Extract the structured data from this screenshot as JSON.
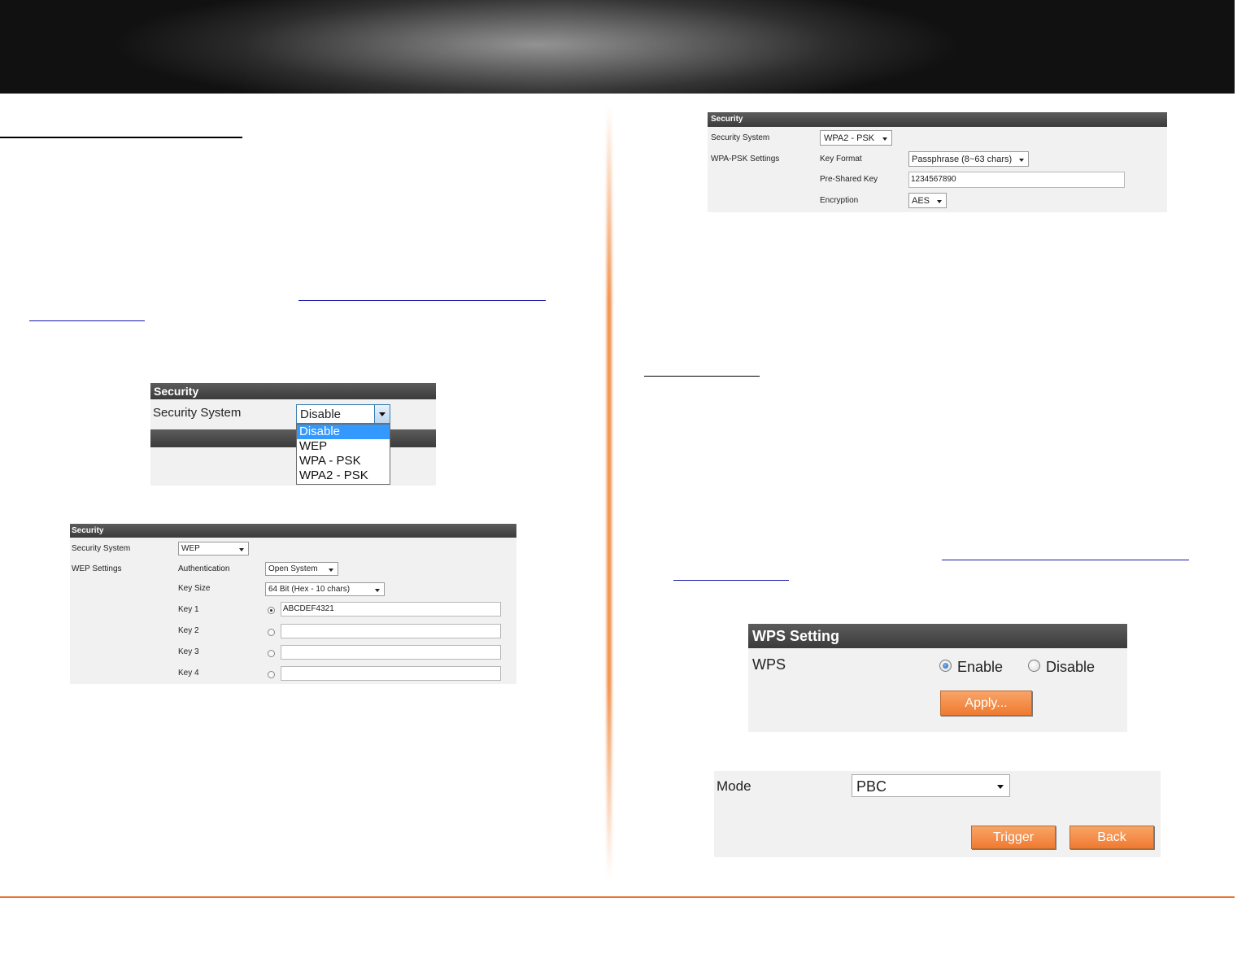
{
  "security_dropdown_panel": {
    "header": "Security",
    "label": "Security System",
    "selected": "Disable",
    "options": [
      "Disable",
      "WEP",
      "WPA - PSK",
      "WPA2 - PSK"
    ]
  },
  "wep_panel": {
    "header": "Security",
    "security_system_label": "Security System",
    "security_system_value": "WEP",
    "wep_settings_label": "WEP Settings",
    "authentication_label": "Authentication",
    "authentication_value": "Open System",
    "key_size_label": "Key Size",
    "key_size_value": "64 Bit (Hex - 10 chars)",
    "keys": [
      {
        "label": "Key 1",
        "value": "ABCDEF4321",
        "selected": true
      },
      {
        "label": "Key 2",
        "value": "",
        "selected": false
      },
      {
        "label": "Key 3",
        "value": "",
        "selected": false
      },
      {
        "label": "Key 4",
        "value": "",
        "selected": false
      }
    ]
  },
  "wpa_panel": {
    "header": "Security",
    "security_system_label": "Security System",
    "security_system_value": "WPA2 - PSK",
    "wpa_psk_settings_label": "WPA-PSK Settings",
    "key_format_label": "Key Format",
    "key_format_value": "Passphrase (8~63 chars)",
    "pre_shared_key_label": "Pre-Shared Key",
    "pre_shared_key_value": "1234567890",
    "encryption_label": "Encryption",
    "encryption_value": "AES"
  },
  "wps_panel": {
    "header": "WPS Setting",
    "wps_label": "WPS",
    "enable_label": "Enable",
    "disable_label": "Disable",
    "enabled": true,
    "apply_label": "Apply..."
  },
  "mode_panel": {
    "mode_label": "Mode",
    "mode_value": "PBC",
    "trigger_label": "Trigger",
    "back_label": "Back"
  },
  "colors": {
    "accent_orange": "#ef7a30",
    "footer_line": "#e8763a",
    "panel_bg": "#f1f1f1",
    "panel_header": "#444444",
    "dropdown_highlight": "#3399ff"
  }
}
